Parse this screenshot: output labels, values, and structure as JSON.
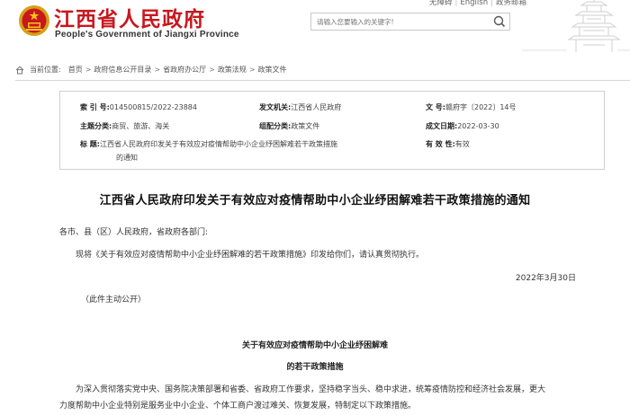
{
  "header": {
    "site_title": "江西省人民政府",
    "site_subtitle": "People's Government of Jiangxi Province",
    "top_links": [
      "无障碍",
      "English",
      "政务邮箱"
    ],
    "search_placeholder": "请输入您要输入的关键字!",
    "colors": {
      "brand": "#c8171e"
    }
  },
  "breadcrumb": {
    "label": "当前位置:",
    "items": [
      "首页",
      "政府信息公开目录",
      "省政府办公厅",
      "政策法规",
      "政策文件"
    ]
  },
  "meta": {
    "index_no_label": "索  引  号:",
    "index_no": "014500815/2022-23884",
    "issuer_label": "发文机关:",
    "issuer": "江西省人民政府",
    "doc_no_label": "文       号:",
    "doc_no": "赣府字〔2022〕14号",
    "topic_label": "主题分类:",
    "topic": "商贸、旅游、海关",
    "category_label": "组配分类:",
    "category": "政策文件",
    "date_label": "成文日期:",
    "date": "2022-03-30",
    "title_label": "标       题:",
    "title_line1": "江西省人民政府印发关于有效应对疫情帮助中小企业纾困解难若干政策措施",
    "title_line2": "的通知",
    "validity_label": "有 效 性:",
    "validity": "有效"
  },
  "article": {
    "title": "江西省人民政府印发关于有效应对疫情帮助中小企业纾困解难若干政策措施的通知",
    "salutation": "各市、县（区）人民政府，省政府各部门:",
    "body": "现将《关于有效应对疫情帮助中小企业纾困解难的若干政策措施》印发给你们，请认真贯彻执行。",
    "sign_date": "2022年3月30日",
    "public_note": "（此件主动公开）",
    "sub_title_1": "关于有效应对疫情帮助中小企业纾困解难",
    "sub_title_2": "的若干政策措施",
    "para_line1": "为深入贯彻落实党中央、国务院决策部署和省委、省政府工作要求，坚持稳字当头、稳中求进，统筹疫情防控和经济社会发展，更大",
    "para_line2": "力度帮助中小企业特别是服务业中小企业、个体工商户渡过难关、恢复发展，特制定以下政策措施。"
  }
}
